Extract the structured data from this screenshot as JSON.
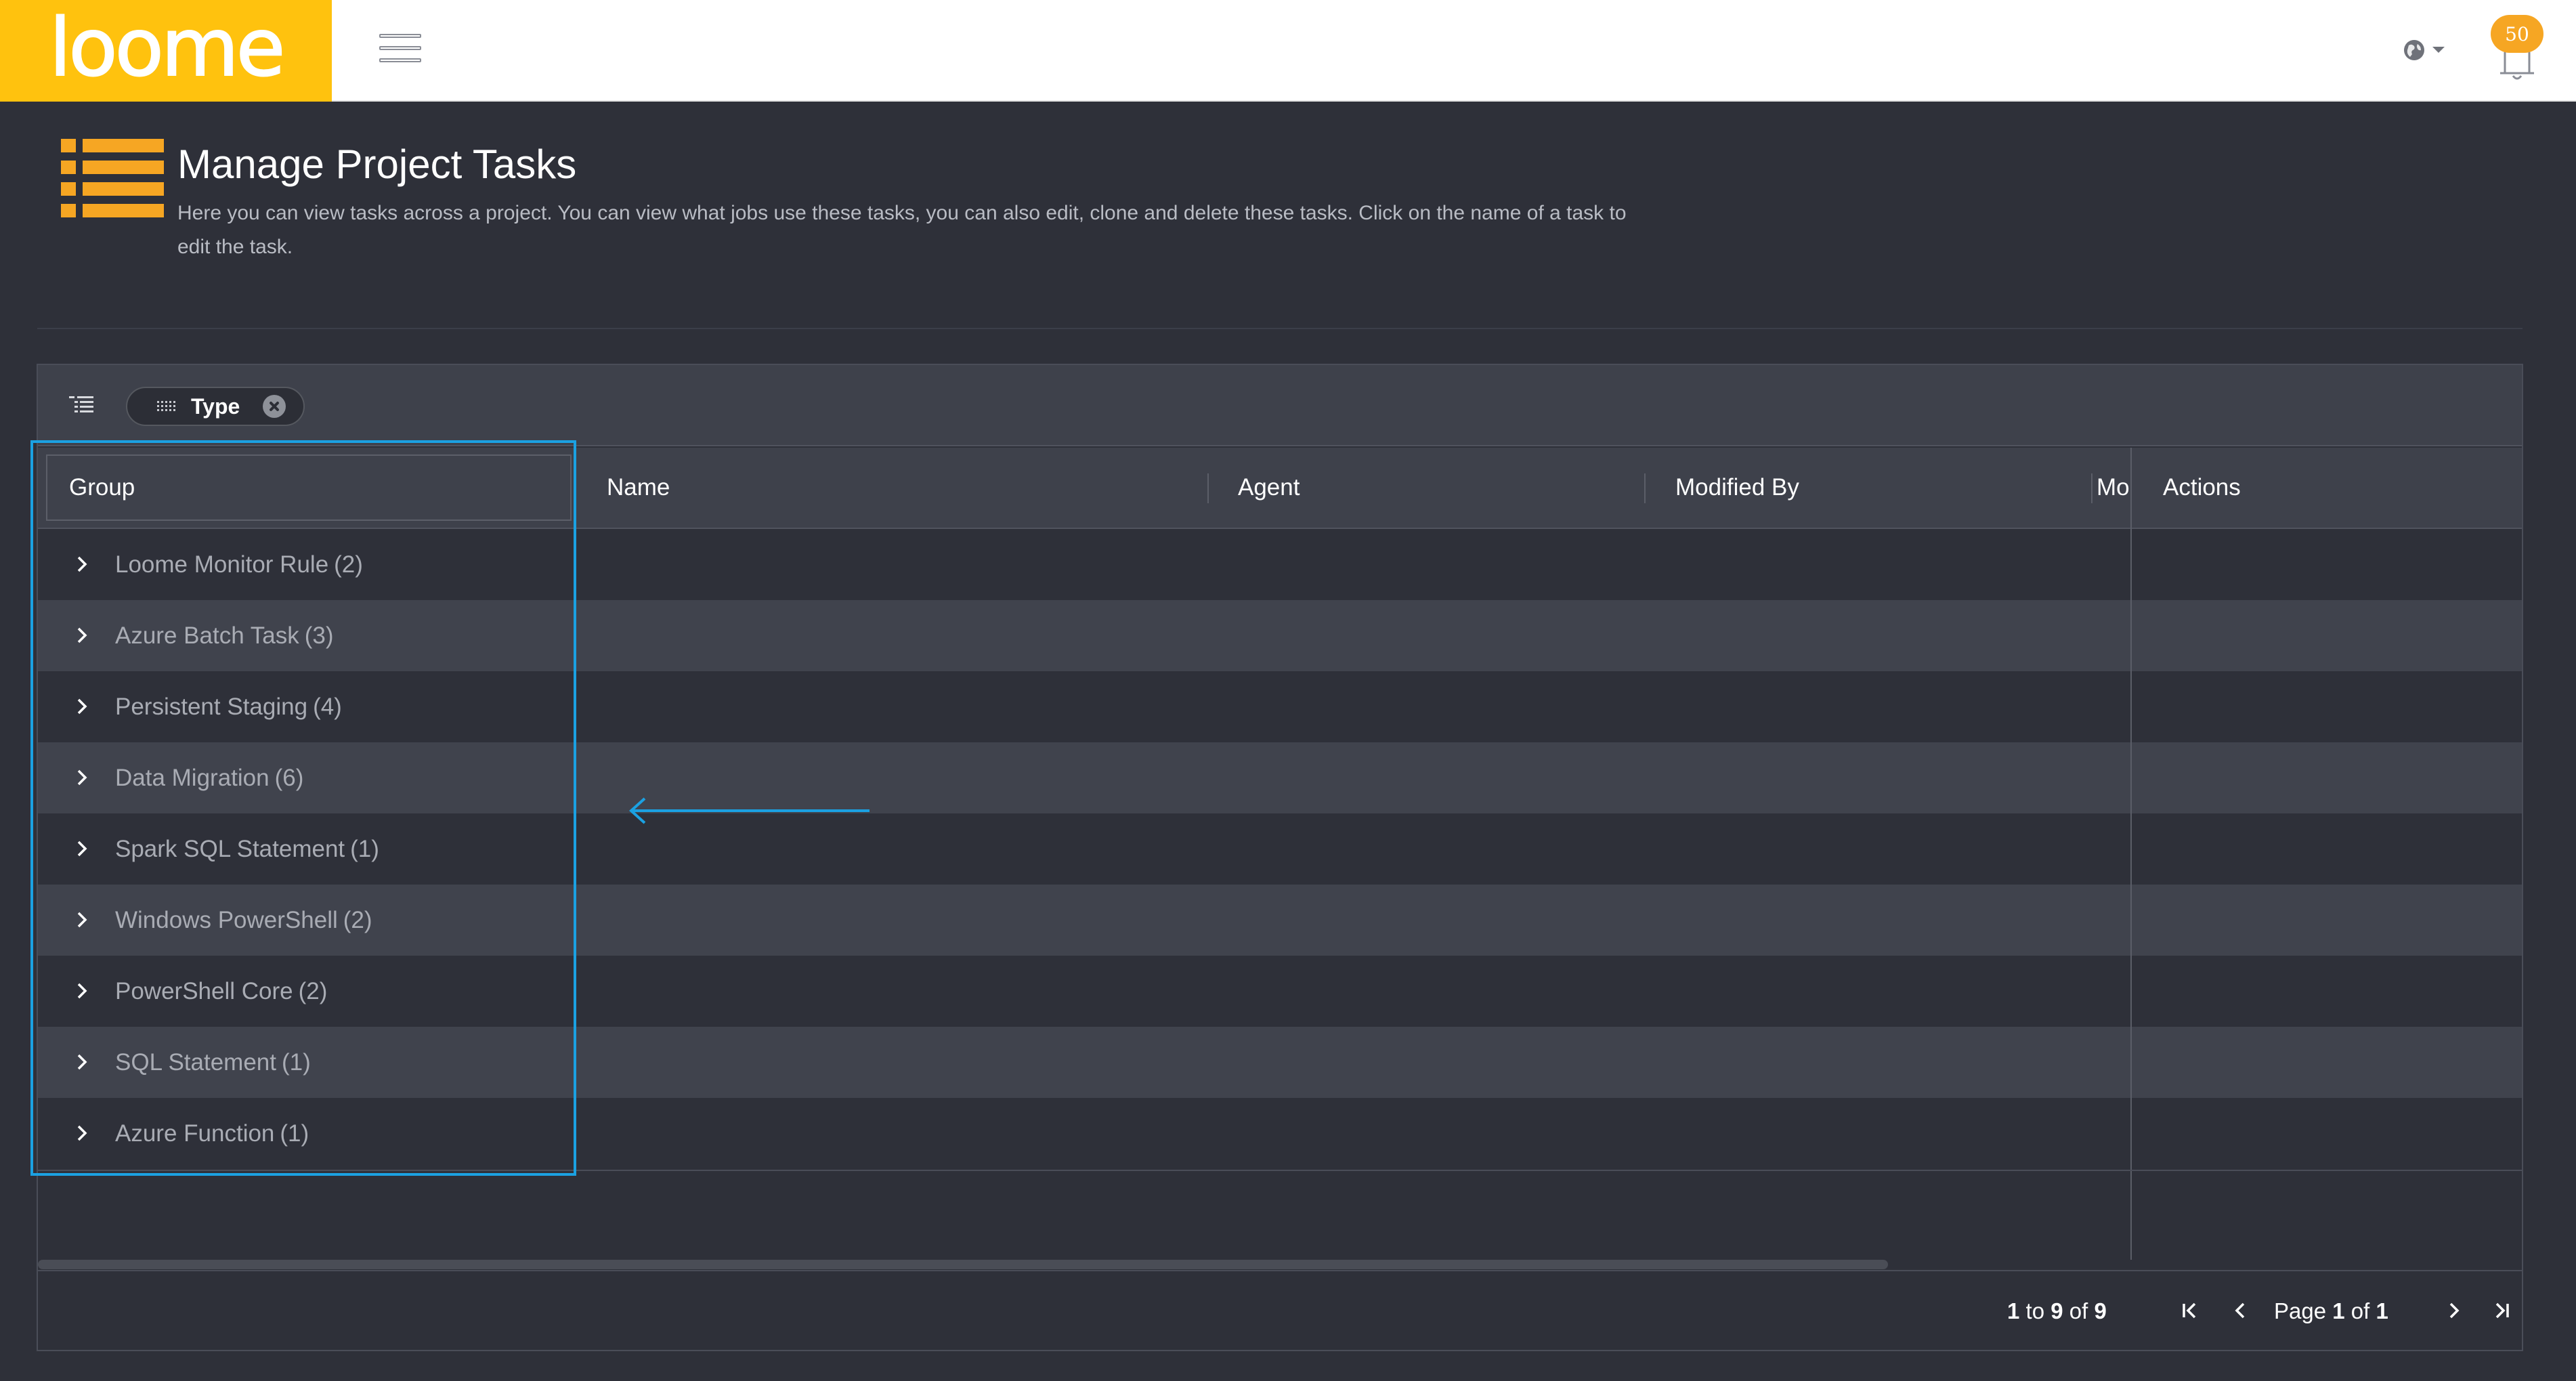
{
  "app": {
    "logo_text": "loome",
    "notification_count": "50"
  },
  "page": {
    "title": "Manage Project Tasks",
    "description": "Here you can view tasks across a project. You can view what jobs use these tasks, you can also edit, clone and delete these tasks. Click on the name of a task to edit the task."
  },
  "toolbar": {
    "group_chip_label": "Type"
  },
  "columns": {
    "group": "Group",
    "name": "Name",
    "agent": "Agent",
    "modified_by": "Modified By",
    "modified_truncated": "Mo",
    "actions": "Actions"
  },
  "groups": [
    {
      "label": "Loome Monitor Rule",
      "count": "(2)"
    },
    {
      "label": "Azure Batch Task",
      "count": "(3)"
    },
    {
      "label": "Persistent Staging",
      "count": "(4)"
    },
    {
      "label": "Data Migration",
      "count": "(6)"
    },
    {
      "label": "Spark SQL Statement",
      "count": "(1)"
    },
    {
      "label": "Windows PowerShell",
      "count": "(2)"
    },
    {
      "label": "PowerShell Core",
      "count": "(2)"
    },
    {
      "label": "SQL Statement",
      "count": "(1)"
    },
    {
      "label": "Azure Function",
      "count": "(1)"
    }
  ],
  "pagination": {
    "from": "1",
    "to_word": "to",
    "to": "9",
    "of_word": "of",
    "total": "9",
    "page_word": "Page",
    "page": "1",
    "page_of_word": "of",
    "page_total": "1"
  },
  "colors": {
    "brand_yellow": "#ffc20e",
    "accent_orange": "#f6a623",
    "background": "#2e3039",
    "annotation_blue": "#1ba1e2"
  },
  "icons": {
    "menu": "hamburger-icon",
    "language": "globe-icon",
    "notifications": "bell-icon",
    "page": "list-icon",
    "group_panel_toggle": "tree-list-icon",
    "chip_grip": "grip-icon",
    "chip_remove": "close-circle-icon",
    "expand": "chevron-right-icon",
    "first_page": "first-page-icon",
    "prev_page": "chevron-left-icon",
    "next_page": "chevron-right-icon",
    "last_page": "last-page-icon"
  }
}
